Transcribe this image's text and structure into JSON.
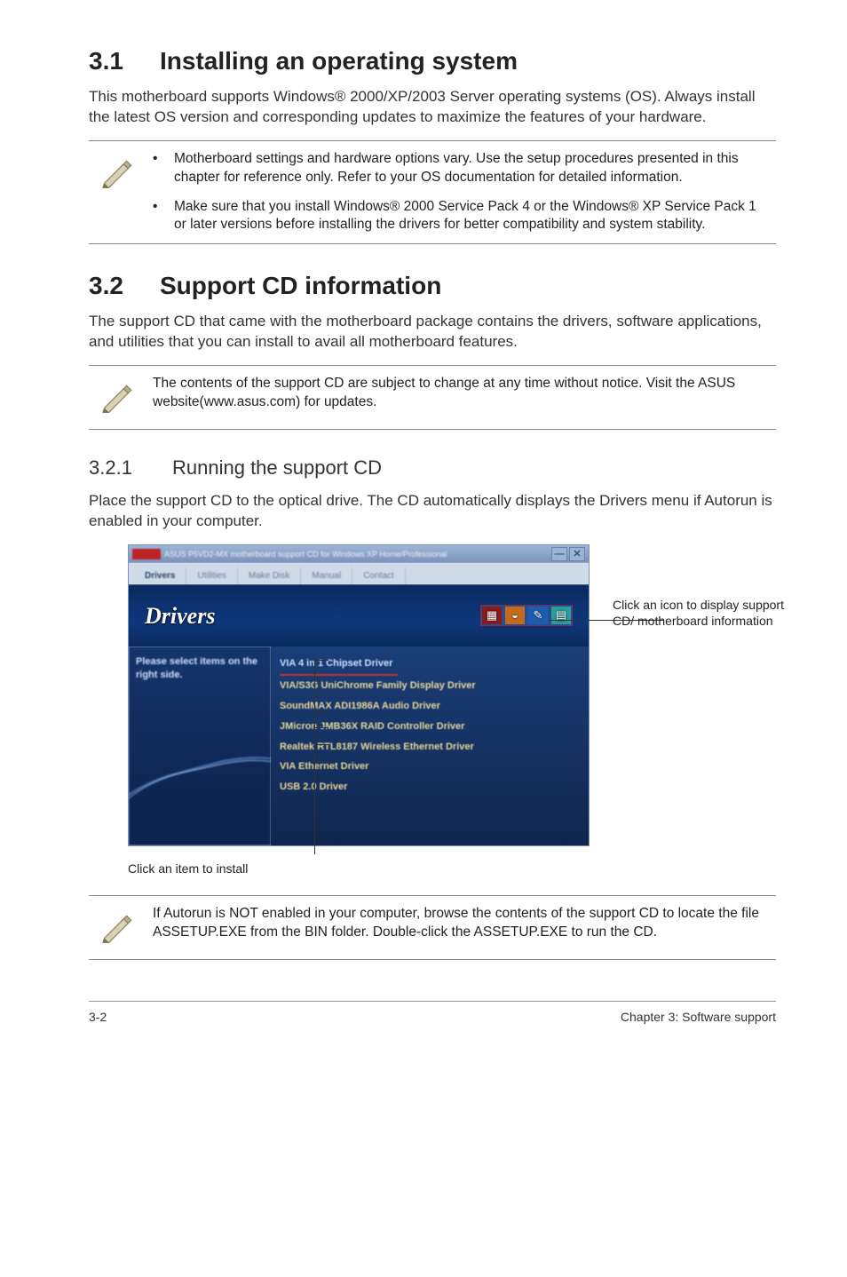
{
  "section31": {
    "num": "3.1",
    "title": "Installing an operating system",
    "para": "This motherboard supports Windows® 2000/XP/2003 Server operating systems (OS). Always install the latest OS version and corresponding updates to maximize the features of your hardware.",
    "notes": [
      "Motherboard settings and hardware options vary. Use the setup procedures presented in this chapter for reference only. Refer to your OS documentation for detailed information.",
      "Make sure that you install Windows® 2000 Service Pack 4 or the Windows® XP Service Pack 1 or later versions before installing the drivers for better compatibility and system stability."
    ]
  },
  "section32": {
    "num": "3.2",
    "title": "Support CD information",
    "para": "The support CD that came with the motherboard package contains the drivers, software applications, and utilities that you can install to avail all motherboard features.",
    "note": "The contents of the support CD are subject to change at any time without notice. Visit the ASUS website(www.asus.com) for updates."
  },
  "sub321": {
    "num": "3.2.1",
    "title": "Running the support CD",
    "para": "Place the support CD to the optical drive. The CD automatically displays the Drivers menu if Autorun is enabled in your computer."
  },
  "screenshot": {
    "titlebar": "ASUS P5VD2-MX motherboard support CD for Windows XP Home/Professional",
    "tabs": [
      "Drivers",
      "Utilities",
      "Make Disk",
      "Manual",
      "Contact"
    ],
    "hero": "Drivers",
    "left_label": "Please select items on the right side.",
    "items": [
      "VIA 4 in 1 Chipset Driver",
      "VIA/S3G UniChrome Family Display Driver",
      "SoundMAX ADI1986A Audio Driver",
      "JMicron JMB36X RAID Controller Driver",
      "Realtek RTL8187 Wireless Ethernet Driver",
      "VIA Ethernet Driver",
      "USB 2.0 Driver"
    ]
  },
  "callouts": {
    "right": "Click an icon to display support CD/ motherboard information",
    "below": "Click an item to install"
  },
  "note_autorun": "If Autorun is NOT enabled in your computer, browse the contents of the support CD to locate the file ASSETUP.EXE from the BIN folder. Double-click the ASSETUP.EXE to run the CD.",
  "footer": {
    "left": "3-2",
    "right": "Chapter 3: Software support"
  }
}
